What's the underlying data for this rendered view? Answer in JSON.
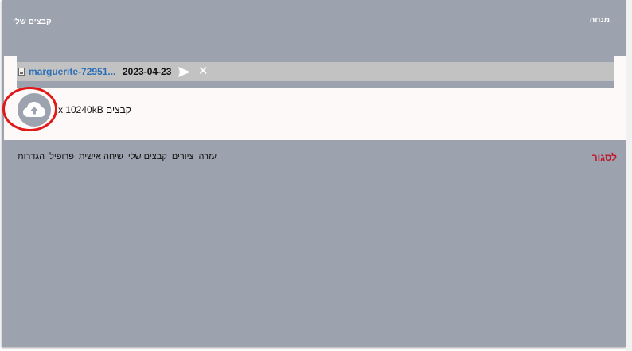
{
  "header": {
    "left_title": "קבצים שלי",
    "right_title": "מנחה"
  },
  "file": {
    "name": "marguerite-72951...",
    "date": "2023-04-23",
    "type_icon": "image-file-icon",
    "send_icon": "send-icon",
    "delete_icon": "close-icon"
  },
  "upload": {
    "icon": "cloud-upload-icon",
    "limit_text": "קבצים x 10240kB"
  },
  "footer": {
    "logout_label": "לסגור",
    "nav": [
      "הגדרות",
      "פרופיל",
      "שיחה אישית",
      "קבצים שלי",
      "ציורים",
      "עזרה"
    ]
  },
  "colors": {
    "background": "#9ca3af",
    "panel": "#fcf9f8",
    "file_row": "#c2c2c2",
    "file_link": "#2c6fb6",
    "logout": "#c0152f",
    "highlight": "#e01818"
  }
}
